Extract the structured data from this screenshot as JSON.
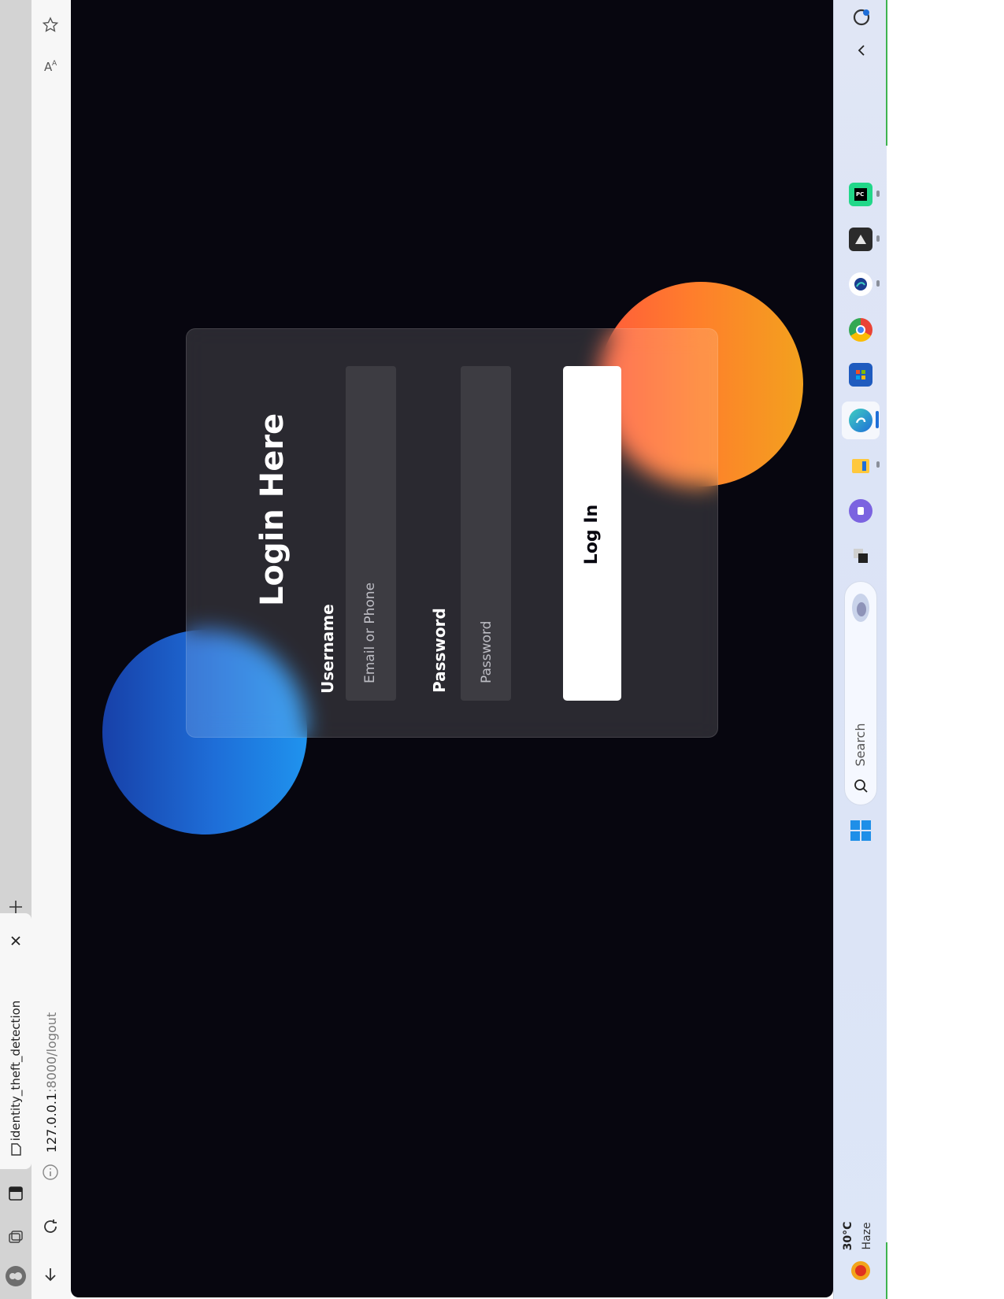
{
  "browser": {
    "tab": {
      "title": "identity_theft_detection"
    },
    "address": {
      "host": "127.0.0.1",
      "rest": ":8000/logout"
    }
  },
  "login": {
    "title": "Login Here",
    "username_label": "Username",
    "username_placeholder": "Email or Phone",
    "password_label": "Password",
    "password_placeholder": "Password",
    "button_label": "Log In"
  },
  "taskbar": {
    "search_label": "Search",
    "weather": {
      "temp": "30°C",
      "condition": "Haze"
    }
  },
  "colors": {
    "page_bg": "#07060f",
    "button_bg": "#ffffff",
    "blob_blue": "#1f93ee",
    "blob_orange": "#ff7d2c"
  }
}
